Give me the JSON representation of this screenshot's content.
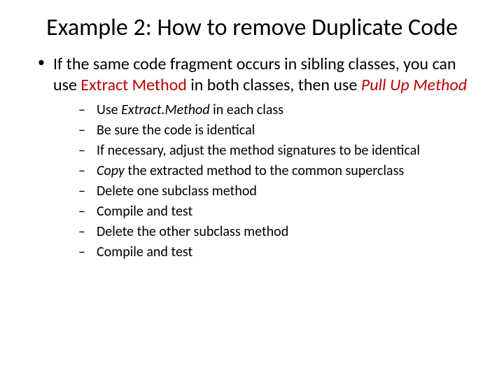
{
  "title": "Example 2: How to remove Duplicate Code",
  "intro": {
    "pre": "If the same code fragment occurs in sibling classes, you can use ",
    "r1": "Extract Method",
    "mid": " in both classes, then use ",
    "r2": "Pull Up Method"
  },
  "steps": [
    {
      "pre": "Use ",
      "em": "Extract.Method",
      "post": " in each class"
    },
    {
      "pre": "Be sure the code is identical",
      "em": "",
      "post": ""
    },
    {
      "pre": "If necessary, adjust the method signatures to be identical",
      "em": "",
      "post": ""
    },
    {
      "pre": "",
      "em": "Copy",
      "post": " the extracted method to the common superclass"
    },
    {
      "pre": "Delete one subclass method",
      "em": "",
      "post": ""
    },
    {
      "pre": "Compile and test",
      "em": "",
      "post": ""
    },
    {
      "pre": "Delete the other subclass method",
      "em": "",
      "post": ""
    },
    {
      "pre": "Compile and test",
      "em": "",
      "post": ""
    }
  ]
}
